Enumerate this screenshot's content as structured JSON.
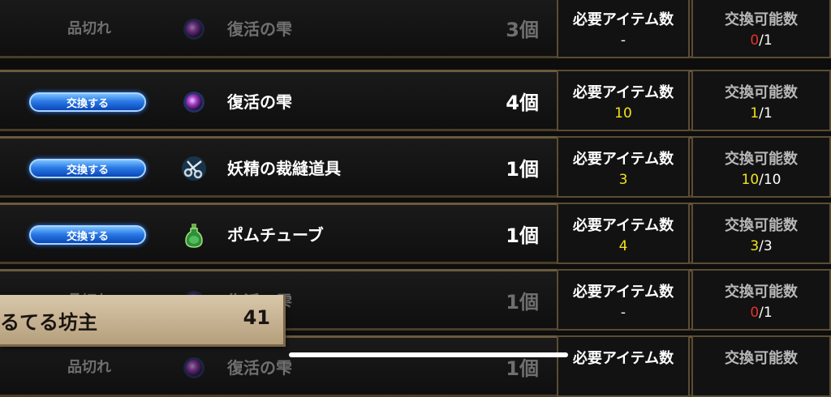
{
  "rows": [
    {
      "status": "soldout",
      "action_label": "品切れ",
      "item_name": "復活の雫",
      "item_icon": "purple-orb-icon",
      "quantity": "3個",
      "required_label": "必要アイテム数",
      "required_value": "-",
      "available_label": "交換可能数",
      "available_current": "0",
      "available_total": "/1",
      "available_color": "#e8302a"
    },
    {
      "status": "available",
      "action_label": "交換する",
      "item_name": "復活の雫",
      "item_icon": "purple-orb-icon",
      "quantity": "4個",
      "required_label": "必要アイテム数",
      "required_value": "10",
      "available_label": "交換可能数",
      "available_current": "1",
      "available_total": "/1",
      "available_color": "#f2e21b"
    },
    {
      "status": "available",
      "action_label": "交換する",
      "item_name": "妖精の裁縫道具",
      "item_icon": "scissors-icon",
      "quantity": "1個",
      "required_label": "必要アイテム数",
      "required_value": "3",
      "available_label": "交換可能数",
      "available_current": "10",
      "available_total": "/10",
      "available_color": "#f2e21b"
    },
    {
      "status": "available",
      "action_label": "交換する",
      "item_name": "ポムチューブ",
      "item_icon": "green-bottle-icon",
      "quantity": "1個",
      "required_label": "必要アイテム数",
      "required_value": "4",
      "available_label": "交換可能数",
      "available_current": "3",
      "available_total": "/3",
      "available_color": "#f2e21b"
    },
    {
      "status": "soldout",
      "action_label": "品切れ",
      "item_name": "復活の雫",
      "item_icon": "purple-orb-icon",
      "quantity": "1個",
      "required_label": "必要アイテム数",
      "required_value": "-",
      "available_label": "交換可能数",
      "available_current": "0",
      "available_total": "/1",
      "available_color": "#e8302a"
    },
    {
      "status": "soldout",
      "action_label": "品切れ",
      "item_name": "復活の雫",
      "item_icon": "purple-orb-icon",
      "quantity": "1個",
      "required_label": "必要アイテム数",
      "required_value": "",
      "available_label": "交換可能数",
      "available_current": "",
      "available_total": "",
      "available_color": "#e8302a"
    }
  ],
  "player": {
    "name": "るてる坊主",
    "score": "41"
  }
}
